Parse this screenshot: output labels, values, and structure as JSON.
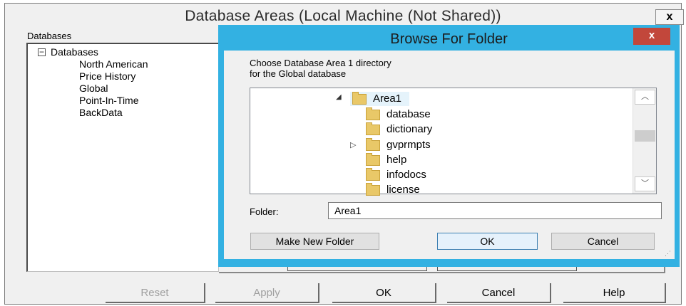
{
  "outer_window": {
    "title": "Database Areas  (Local Machine (Not Shared))",
    "close_glyph": "x",
    "databases_label": "Databases",
    "tree": {
      "expander": "−",
      "root": "Databases",
      "children": [
        "North American",
        "Price History",
        "Global",
        "Point-In-Time",
        "BackData"
      ]
    },
    "buttons": {
      "reset": "Reset",
      "apply": "Apply",
      "ok": "OK",
      "cancel": "Cancel",
      "help": "Help"
    }
  },
  "browse_dialog": {
    "title": "Browse For Folder",
    "close_glyph": "x",
    "instruction_line1": "Choose Database Area 1 directory",
    "instruction_line2": "for the Global database",
    "folder_tree": {
      "root": {
        "label": "Area1",
        "expand_glyph": "◢"
      },
      "children": [
        {
          "label": "database",
          "glyph": ""
        },
        {
          "label": "dictionary",
          "glyph": ""
        },
        {
          "label": "gvprmpts",
          "glyph": "▷"
        },
        {
          "label": "help",
          "glyph": ""
        },
        {
          "label": "infodocs",
          "glyph": ""
        },
        {
          "label": "license",
          "glyph": ""
        }
      ]
    },
    "scroll_up_glyph": "︿",
    "scroll_down_glyph": "﹀",
    "folder_label": "Folder:",
    "folder_value": "Area1",
    "make_new_folder": "Make New Folder",
    "ok": "OK",
    "cancel": "Cancel",
    "grip_glyph": "⋰"
  },
  "colors": {
    "dialog_border": "#33b1e2",
    "close_button": "#c2473b",
    "folder_icon": "#e9c868",
    "selection": "#e5f3fb"
  }
}
